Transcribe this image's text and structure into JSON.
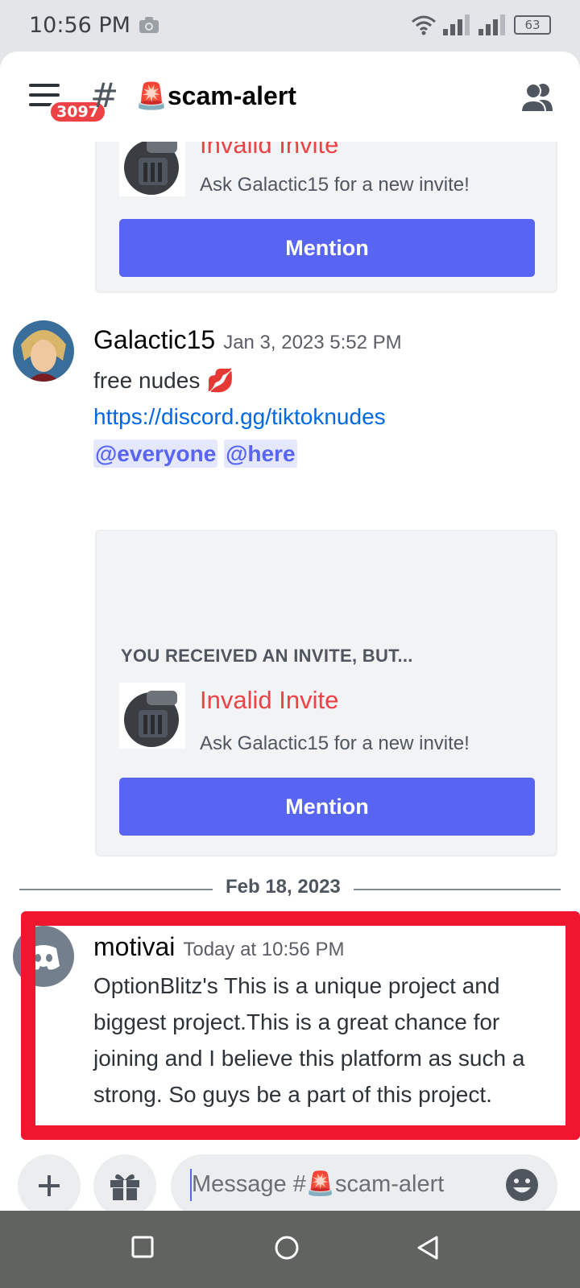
{
  "status": {
    "time": "10:56 PM",
    "battery": "63",
    "camera_icon": "camera-icon",
    "wifi_icon": "wifi-icon",
    "signal_icon": "signal-icon"
  },
  "header": {
    "badge": "3097",
    "hash": "#",
    "channel_emoji": "🚨",
    "channel_name": "scam-alert",
    "menu_icon": "menu-icon",
    "members_icon": "members-icon"
  },
  "embed_top": {
    "title": "Invalid Invite",
    "subtitle": "Ask Galactic15 for a new invite!",
    "button": "Mention"
  },
  "message1": {
    "author": "Galactic15",
    "timestamp": "Jan 3, 2023 5:52 PM",
    "text": "free nudes",
    "emoji": "💋",
    "link": "https://discord.gg/tiktoknudes",
    "mention_everyone": "@everyone",
    "mention_here": "@here"
  },
  "embed_bottom": {
    "heading": "YOU RECEIVED AN INVITE, BUT...",
    "title": "Invalid Invite",
    "subtitle": "Ask Galactic15 for a new invite!",
    "button": "Mention"
  },
  "divider": {
    "date": "Feb 18, 2023"
  },
  "message2": {
    "author": "motivai",
    "timestamp": "Today at 10:56 PM",
    "text_lines": [
      "OptionBlitz's This is a unique project and",
      "biggest project.This  is a great chance for",
      "joining and I believe this platform as such a",
      "strong. So guys be a part of this project."
    ]
  },
  "composer": {
    "placeholder": "Message #🚨scam-alert",
    "add_icon": "plus-icon",
    "gift_icon": "gift-icon",
    "emoji_icon": "emoji-icon"
  },
  "nav": {
    "recents_icon": "square-icon",
    "home_icon": "circle-icon",
    "back_icon": "triangle-back-icon"
  },
  "colors": {
    "blurple": "#5865f2",
    "danger": "#ed4245",
    "highlight_border": "#f0162f",
    "link": "#0068e0"
  }
}
